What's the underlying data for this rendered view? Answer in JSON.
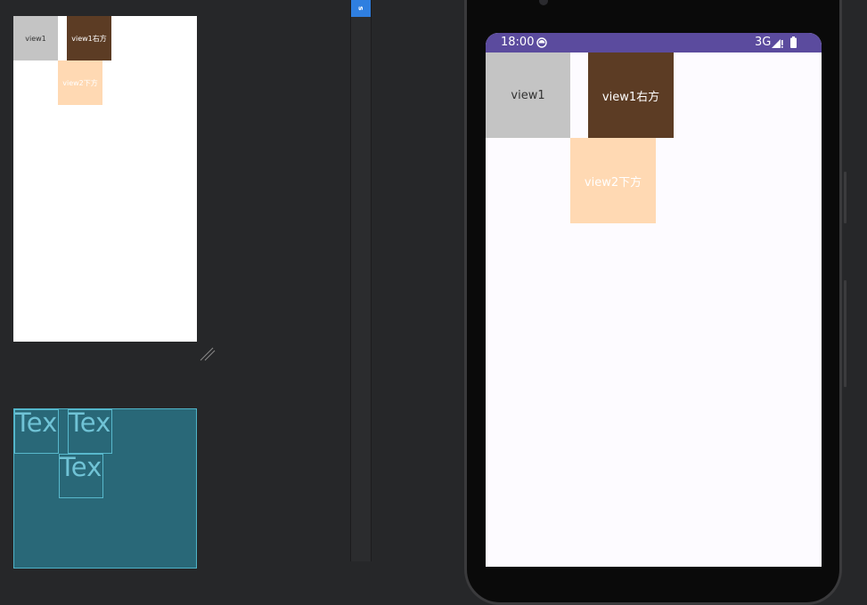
{
  "design_preview": {
    "view1_label": "view1",
    "view2_label": "view1右方",
    "view3_label": "view2下方"
  },
  "blueprint_preview": {
    "view1_text": "Tex",
    "view2_text": "Tex",
    "view3_text": "Tex"
  },
  "side_tab": {
    "label": "s"
  },
  "emulator": {
    "status_bar": {
      "time": "18:00",
      "network": "3G",
      "icons": [
        "app-notification-icon",
        "signal-icon",
        "battery-icon"
      ]
    },
    "views": {
      "view1_label": "view1",
      "view2_label": "view1右方",
      "view3_label": "view2下方"
    }
  },
  "colors": {
    "ide_background": "#262729",
    "status_bar": "#5b4b9e",
    "view1": "#c4c4c4",
    "view2": "#5c3c24",
    "view3": "#ffd9b3",
    "blueprint": "#296878"
  }
}
